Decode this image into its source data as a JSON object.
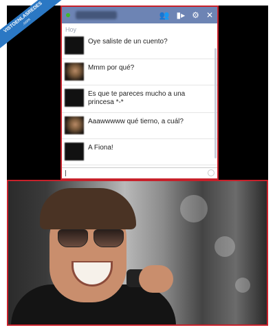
{
  "chat": {
    "window_title": "",
    "header_icons": [
      "add-friend-icon",
      "video-call-icon",
      "settings-gear-icon",
      "close-icon"
    ],
    "day_label": "Hoy",
    "messages": [
      {
        "text": "Oye saliste de un cuento?"
      },
      {
        "text": "Mmm por qué?"
      },
      {
        "text": "Es que te pareces mucho a una princesa *-*"
      },
      {
        "text": "Aaawwwww qué tierno, a cuál?"
      },
      {
        "text": "A Fiona!"
      }
    ],
    "input_value": ""
  },
  "watermark": {
    "line1": "VISTOENLASREDES",
    "line2": ".com"
  },
  "colors": {
    "facebook_header": "#6d84b4",
    "border_red": "#c8202a",
    "online_green": "#42b72a"
  }
}
